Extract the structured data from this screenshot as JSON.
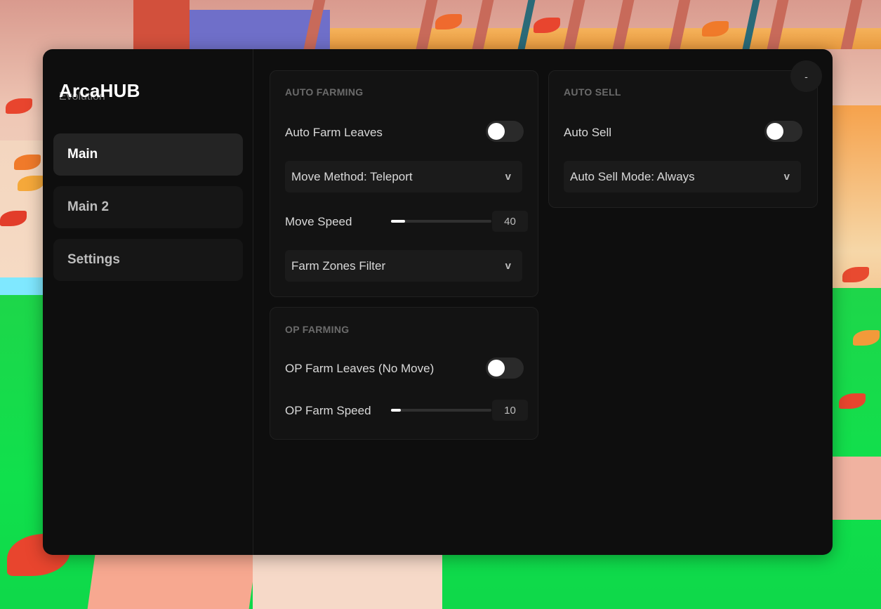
{
  "brand": {
    "title": "ArcaHUB",
    "subtitle": "Evolution"
  },
  "sidebar": {
    "items": [
      {
        "label": "Main",
        "active": true
      },
      {
        "label": "Main 2",
        "active": false
      },
      {
        "label": "Settings",
        "active": false
      }
    ]
  },
  "window": {
    "minimize_label": "-"
  },
  "auto_farming": {
    "title": "AUTO FARMING",
    "auto_farm_leaves": {
      "label": "Auto Farm Leaves",
      "enabled": false
    },
    "move_method": {
      "label": "Move Method: Teleport",
      "arrow": "v"
    },
    "move_speed": {
      "label": "Move Speed",
      "value": "40",
      "fraction": 0.14
    },
    "farm_zones": {
      "label": "Farm Zones Filter",
      "arrow": "v"
    }
  },
  "op_farming": {
    "title": "OP FARMING",
    "op_farm_leaves": {
      "label": "OP Farm Leaves (No Move)",
      "enabled": false
    },
    "op_farm_speed": {
      "label": "OP Farm Speed",
      "value": "10",
      "fraction": 0.1
    }
  },
  "auto_sell": {
    "title": "AUTO SELL",
    "auto_sell_toggle": {
      "label": "Auto Sell",
      "enabled": false
    },
    "mode": {
      "label": "Auto Sell Mode: Always",
      "arrow": "v"
    }
  },
  "colors": {
    "window_bg": "#0e0e0e",
    "panel_bg": "#131313",
    "accent": "#ffffff",
    "active_nav": "#242424"
  }
}
